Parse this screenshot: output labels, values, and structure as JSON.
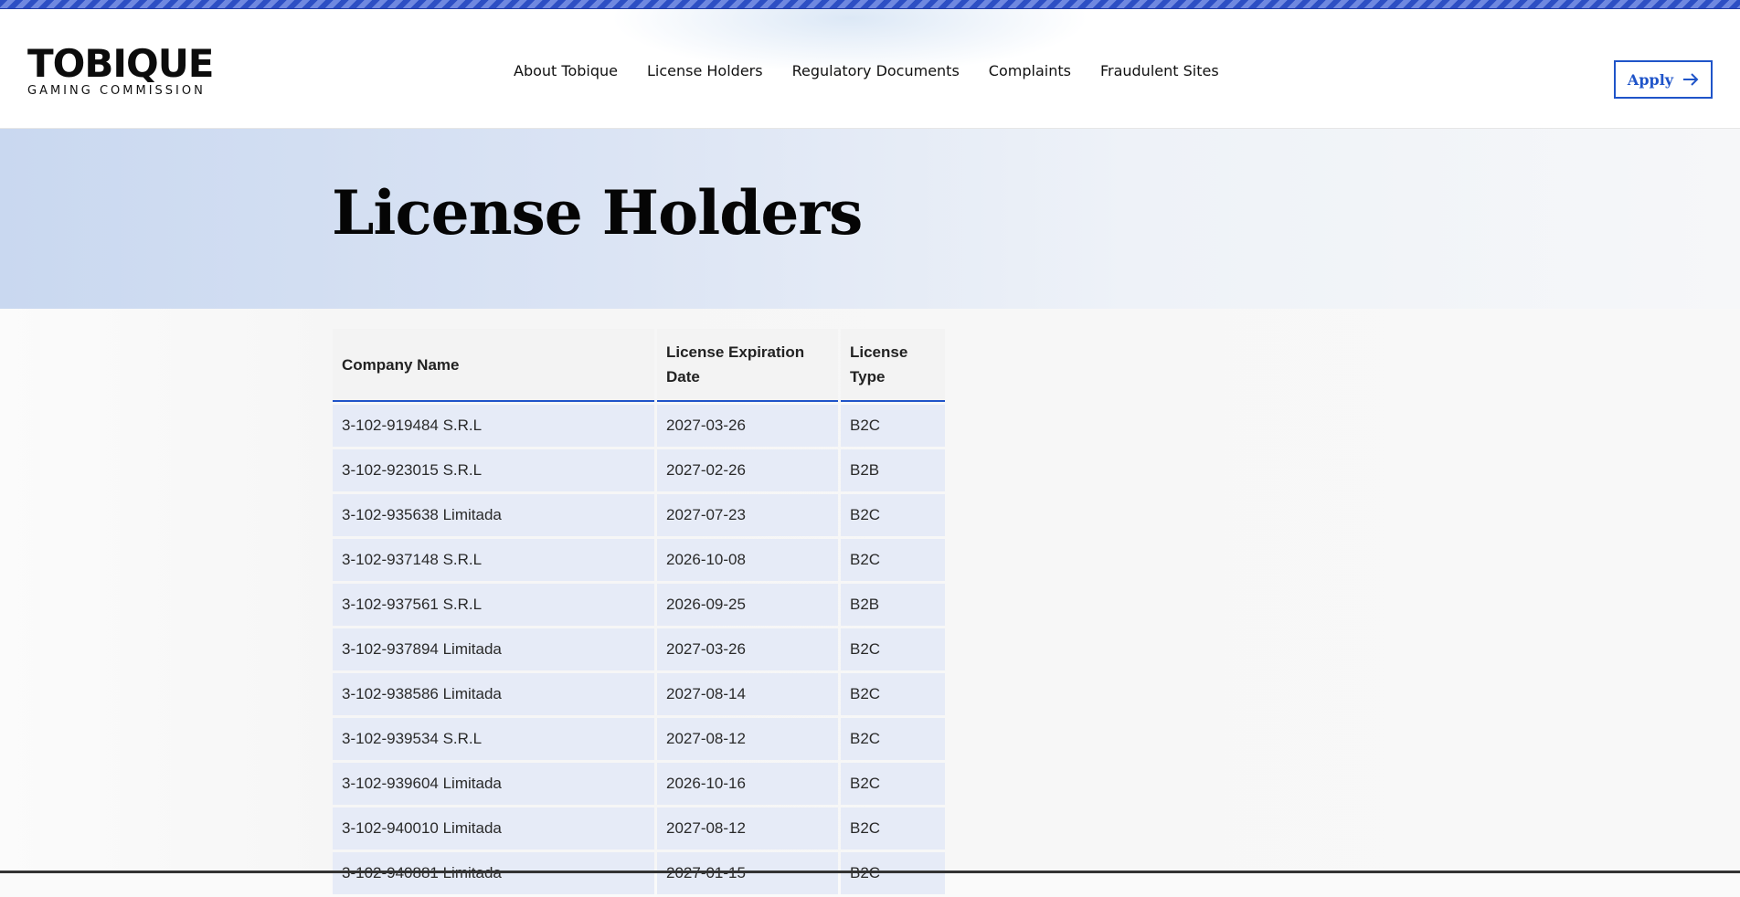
{
  "logo": {
    "main": "TOBIQUE",
    "sub": "GAMING COMMISSION"
  },
  "nav": [
    {
      "label": "About Tobique"
    },
    {
      "label": "License Holders"
    },
    {
      "label": "Regulatory Documents"
    },
    {
      "label": "Complaints"
    },
    {
      "label": "Fraudulent Sites"
    }
  ],
  "apply": {
    "label": "Apply",
    "icon": "arrow-right-icon"
  },
  "hero": {
    "title": "License Holders"
  },
  "table": {
    "headers": {
      "company": "Company Name",
      "expiration": "License Expiration Date",
      "type": "License Type"
    },
    "rows": [
      {
        "company": "3-102-919484 S.R.L",
        "expiration": "2027-03-26",
        "type": "B2C"
      },
      {
        "company": "3-102-923015 S.R.L",
        "expiration": "2027-02-26",
        "type": "B2B"
      },
      {
        "company": "3-102-935638 Limitada",
        "expiration": "2027-07-23",
        "type": "B2C"
      },
      {
        "company": "3-102-937148 S.R.L",
        "expiration": "2026-10-08",
        "type": "B2C"
      },
      {
        "company": "3-102-937561 S.R.L",
        "expiration": "2026-09-25",
        "type": "B2B"
      },
      {
        "company": "3-102-937894 Limitada",
        "expiration": "2027-03-26",
        "type": "B2C"
      },
      {
        "company": "3-102-938586 Limitada",
        "expiration": "2027-08-14",
        "type": "B2C"
      },
      {
        "company": "3-102-939534 S.R.L",
        "expiration": "2027-08-12",
        "type": "B2C"
      },
      {
        "company": "3-102-939604 Limitada",
        "expiration": "2026-10-16",
        "type": "B2C"
      },
      {
        "company": "3-102-940010 Limitada",
        "expiration": "2027-08-12",
        "type": "B2C"
      },
      {
        "company": "3-102-940881 Limitada",
        "expiration": "2027-01-15",
        "type": "B2C"
      }
    ]
  },
  "colors": {
    "accent": "#1f54c9",
    "stripe": "#2d4fc4",
    "row_bg": "#e6ebf7",
    "header_bg": "#f3f3f3"
  }
}
